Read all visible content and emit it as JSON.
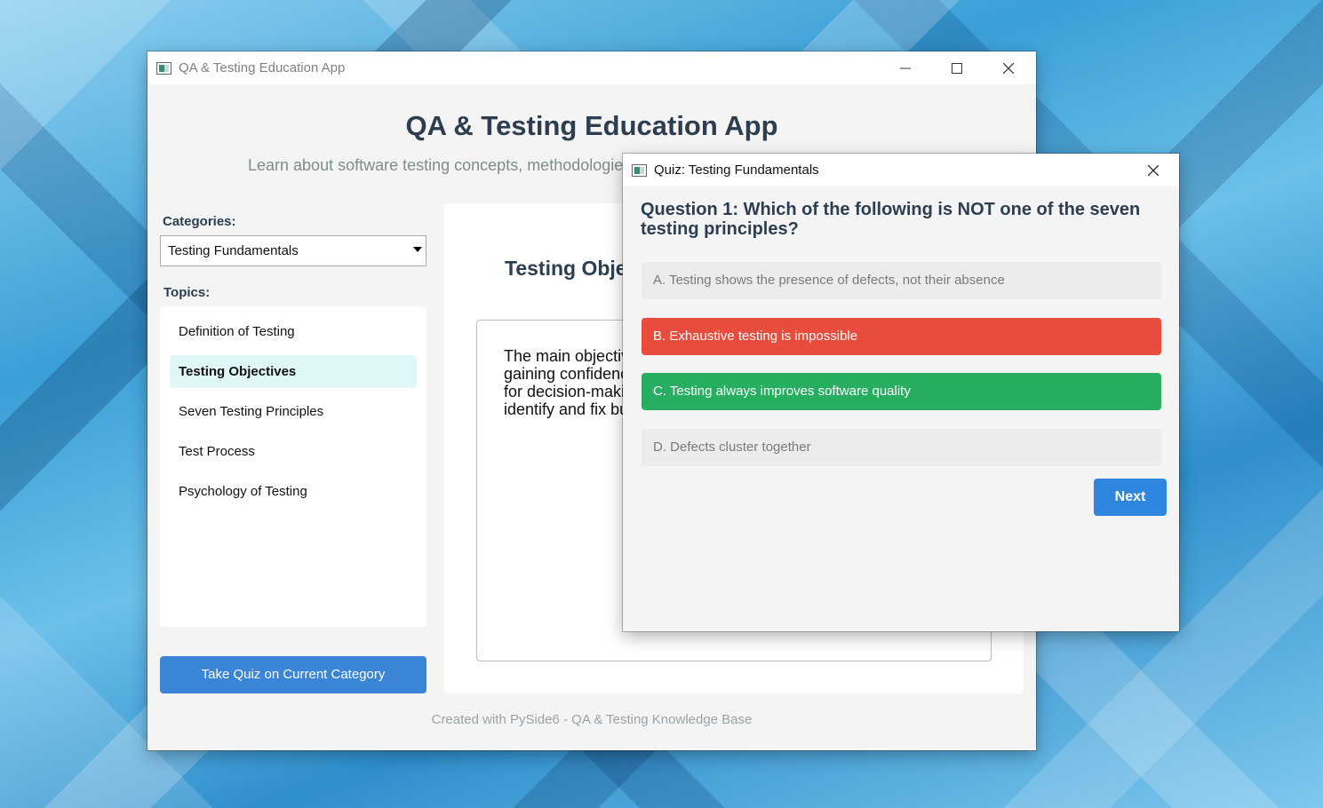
{
  "main_window": {
    "title": "QA & Testing Education App",
    "app_title": "QA & Testing Education App",
    "subtitle": "Learn about software testing concepts, methodologies,",
    "categories_label": "Categories:",
    "category_selected": "Testing Fundamentals",
    "topics_label": "Topics:",
    "topics": [
      {
        "label": "Definition of Testing",
        "selected": false
      },
      {
        "label": "Testing Objectives",
        "selected": true
      },
      {
        "label": "Seven Testing Principles",
        "selected": false
      },
      {
        "label": "Test Process",
        "selected": false
      },
      {
        "label": "Psychology of Testing",
        "selected": false
      }
    ],
    "quiz_button": "Take Quiz on Current Category",
    "content_title": "Testing Obje",
    "content_lines": [
      "The main objectiv",
      "gaining confidenc",
      "for decision-makir",
      "identify and fix bu"
    ],
    "footer": "Created with PySide6 - QA & Testing Knowledge Base"
  },
  "quiz_dialog": {
    "title": "Quiz: Testing Fundamentals",
    "question": "Question 1: Which of the following is NOT one of the seven testing principles?",
    "options": [
      {
        "label": "A. Testing shows the presence of defects, not their absence",
        "state": "neutral"
      },
      {
        "label": "B. Exhaustive testing is impossible",
        "state": "wrong"
      },
      {
        "label": "C. Testing always improves software quality",
        "state": "correct"
      },
      {
        "label": "D. Defects cluster together",
        "state": "neutral"
      }
    ],
    "next_button": "Next"
  },
  "colors": {
    "accent_blue": "#2e86de",
    "wrong_red": "#e74c3c",
    "correct_green": "#27ae60",
    "selected_topic_bg": "#e0f7fa",
    "heading": "#2c3e50"
  },
  "icons": {
    "window_minimize": "minimize-icon",
    "window_maximize": "maximize-icon",
    "window_close": "close-icon",
    "app_icon": "app-window-icon",
    "dropdown": "chevron-down-icon"
  }
}
